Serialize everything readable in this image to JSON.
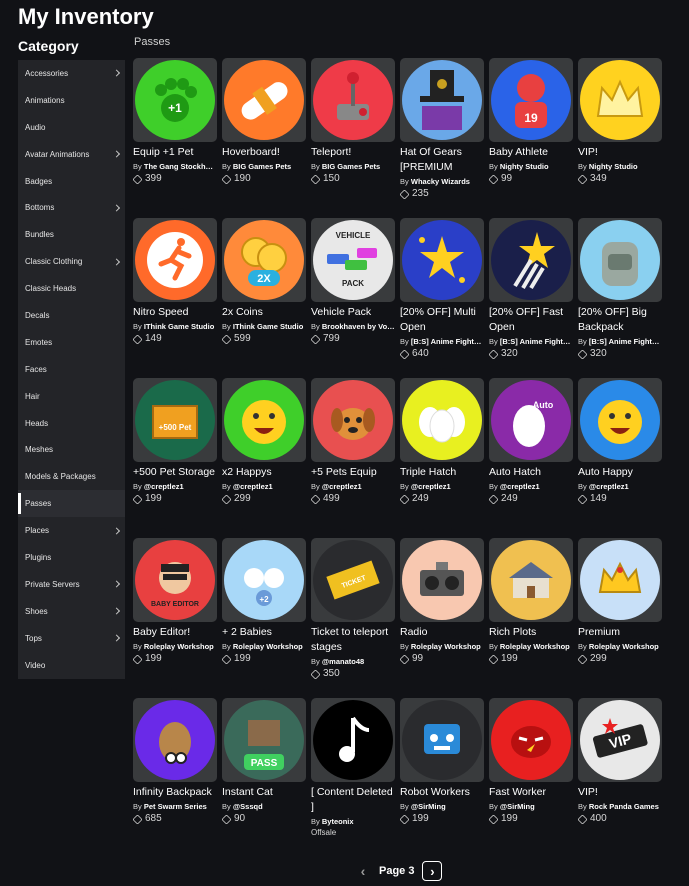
{
  "page": {
    "title": "My Inventory"
  },
  "sidebar": {
    "title": "Category",
    "items": [
      {
        "label": "Accessories",
        "chevron": true
      },
      {
        "label": "Animations",
        "chevron": false
      },
      {
        "label": "Audio",
        "chevron": false
      },
      {
        "label": "Avatar Animations",
        "chevron": true
      },
      {
        "label": "Badges",
        "chevron": false
      },
      {
        "label": "Bottoms",
        "chevron": true
      },
      {
        "label": "Bundles",
        "chevron": false
      },
      {
        "label": "Classic Clothing",
        "chevron": true
      },
      {
        "label": "Classic Heads",
        "chevron": false
      },
      {
        "label": "Decals",
        "chevron": false
      },
      {
        "label": "Emotes",
        "chevron": false
      },
      {
        "label": "Faces",
        "chevron": false
      },
      {
        "label": "Hair",
        "chevron": false
      },
      {
        "label": "Heads",
        "chevron": false
      },
      {
        "label": "Meshes",
        "chevron": false
      },
      {
        "label": "Models & Packages",
        "chevron": false
      },
      {
        "label": "Passes",
        "chevron": false,
        "active": true
      },
      {
        "label": "Places",
        "chevron": true
      },
      {
        "label": "Plugins",
        "chevron": false
      },
      {
        "label": "Private Servers",
        "chevron": true
      },
      {
        "label": "Shoes",
        "chevron": true
      },
      {
        "label": "Tops",
        "chevron": true
      },
      {
        "label": "Video",
        "chevron": false
      }
    ]
  },
  "main": {
    "section_label": "Passes",
    "by_label": "By",
    "items": [
      {
        "name": "Equip +1 Pet",
        "creator": "The Gang Stockholm",
        "price": "399",
        "icon": "paw-plus-one-icon",
        "bg": "#3fcf2a"
      },
      {
        "name": "Hoverboard!",
        "creator": "BIG Games Pets",
        "price": "190",
        "icon": "hoverboard-icon",
        "bg": "#ff7a2a"
      },
      {
        "name": "Teleport!",
        "creator": "BIG Games Pets",
        "price": "150",
        "icon": "joystick-icon",
        "bg": "#ef3b48"
      },
      {
        "name": "Hat Of Gears [PREMIUM MEMBERS ONLY]",
        "creator": "Whacky Wizards",
        "price": "235",
        "icon": "gear-hat-icon",
        "bg": "#6aa8e8"
      },
      {
        "name": "Baby Athlete",
        "creator": "Nighty Studio",
        "price": "99",
        "icon": "athlete-icon",
        "bg": "#2a63e8"
      },
      {
        "name": "VIP!",
        "creator": "Nighty Studio",
        "price": "349",
        "icon": "crown-icon",
        "bg": "#ffd21f"
      },
      {
        "name": "Nitro Speed",
        "creator": "IThink Game Studio",
        "price": "149",
        "icon": "runner-icon",
        "bg": "#ff6a2a"
      },
      {
        "name": "2x Coins",
        "creator": "IThink Game Studio",
        "price": "599",
        "icon": "coins-2x-icon",
        "bg": "#ff8a3a"
      },
      {
        "name": "Vehicle Pack",
        "creator": "Brookhaven by Voldex",
        "price": "799",
        "icon": "vehicle-pack-icon",
        "bg": "#e8e8e8"
      },
      {
        "name": "[20% OFF] Multi Open",
        "creator": "[B:S] Anime Fighters",
        "price": "640",
        "icon": "stars-multi-icon",
        "bg": "#2a3fc8"
      },
      {
        "name": "[20% OFF] Fast Open",
        "creator": "[B:S] Anime Fighters",
        "price": "320",
        "icon": "star-claw-icon",
        "bg": "#1a1f4a"
      },
      {
        "name": "[20% OFF] Big Backpack",
        "creator": "[B:S] Anime Fighters",
        "price": "320",
        "icon": "backpack-icon",
        "bg": "#8ad0f0"
      },
      {
        "name": "+500 Pet Storage",
        "creator": "@creptlez1",
        "price": "199",
        "icon": "storage-box-icon",
        "bg": "#1a6a4a"
      },
      {
        "name": "x2 Happys",
        "creator": "@creptlez1",
        "price": "299",
        "icon": "laughing-emoji-icon",
        "bg": "#3fcf2a"
      },
      {
        "name": "+5 Pets Equip",
        "creator": "@creptlez1",
        "price": "499",
        "icon": "dog-face-icon",
        "bg": "#e85050"
      },
      {
        "name": "Triple Hatch",
        "creator": "@creptlez1",
        "price": "249",
        "icon": "triple-egg-icon",
        "bg": "#e8f020"
      },
      {
        "name": "Auto Hatch",
        "creator": "@creptlez1",
        "price": "249",
        "icon": "egg-hatch-icon",
        "bg": "#8a2aa8"
      },
      {
        "name": "Auto Happy",
        "creator": "@creptlez1",
        "price": "149",
        "icon": "happy-emoji-icon",
        "bg": "#2a8ae8"
      },
      {
        "name": "Baby Editor!",
        "creator": "Roleplay Workshop",
        "price": "199",
        "icon": "baby-editor-icon",
        "bg": "#e84040"
      },
      {
        "name": "+ 2 Babies",
        "creator": "Roleplay Workshop",
        "price": "199",
        "icon": "babies-icon",
        "bg": "#a8d8f8"
      },
      {
        "name": "Ticket to teleport stages",
        "creator": "@manato48",
        "price": "350",
        "icon": "ticket-icon",
        "bg": "#2a2b2e"
      },
      {
        "name": "Radio",
        "creator": "Roleplay Workshop",
        "price": "99",
        "icon": "radio-icon",
        "bg": "#f8c8b0"
      },
      {
        "name": "Rich Plots",
        "creator": "Roleplay Workshop",
        "price": "199",
        "icon": "mansion-icon",
        "bg": "#f0c050"
      },
      {
        "name": "Premium",
        "creator": "Roleplay Workshop",
        "price": "299",
        "icon": "premium-crown-icon",
        "bg": "#c8e0f8"
      },
      {
        "name": "Infinity Backpack",
        "creator": "Pet Swarm Series",
        "price": "685",
        "icon": "infinity-bag-icon",
        "bg": "#6a2ae8"
      },
      {
        "name": "Instant Cat",
        "creator": "@Sssqd",
        "price": "90",
        "icon": "cat-pass-icon",
        "bg": "#3a6a5a"
      },
      {
        "name": "[ Content Deleted ]",
        "creator": "Byteonix",
        "price": "",
        "status": "Offsale",
        "icon": "music-note-icon",
        "bg": "#000000"
      },
      {
        "name": "Robot Workers",
        "creator": "@SirMing",
        "price": "199",
        "icon": "robot-icon",
        "bg": "#2a2b2e"
      },
      {
        "name": "Fast Worker",
        "creator": "@SirMing",
        "price": "199",
        "icon": "flash-mask-icon",
        "bg": "#e82020"
      },
      {
        "name": "VIP!",
        "creator": "Rock Panda Games",
        "price": "400",
        "icon": "vip-stars-icon",
        "bg": "#e8e8e8"
      }
    ]
  },
  "pagination": {
    "label": "Page 3",
    "prev": "‹",
    "next": "›"
  }
}
